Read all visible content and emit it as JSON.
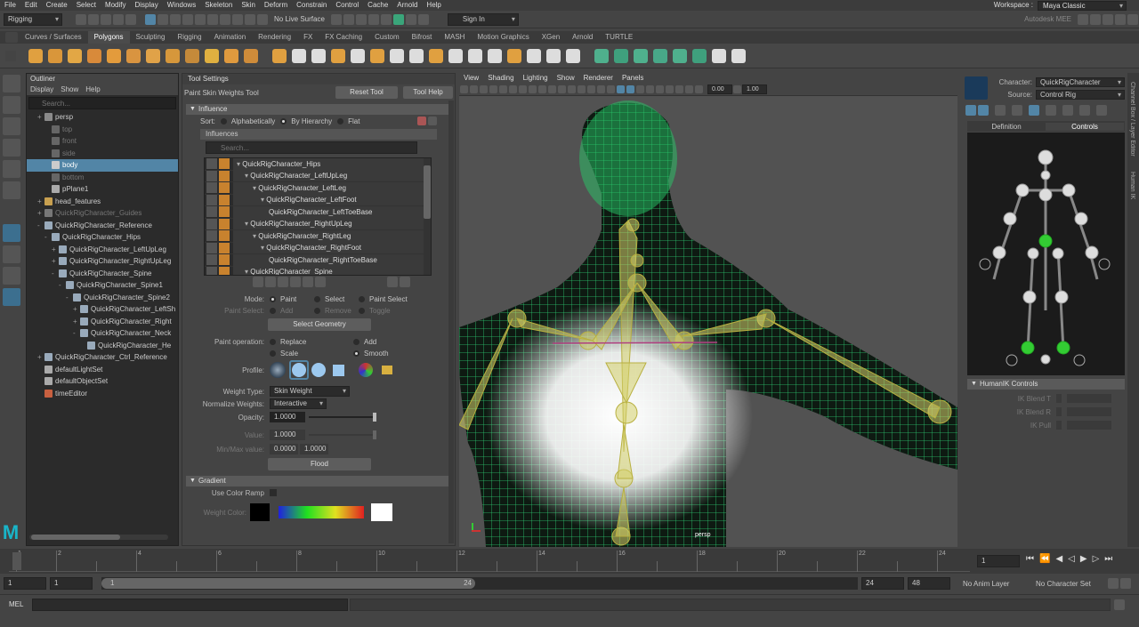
{
  "menubar": {
    "items": [
      "File",
      "Edit",
      "Create",
      "Select",
      "Modify",
      "Display",
      "Windows",
      "Skeleton",
      "Skin",
      "Deform",
      "Constrain",
      "Control",
      "Cache",
      "Arnold",
      "Help"
    ],
    "workspace_label": "Workspace :",
    "workspace_value": "Maya Classic"
  },
  "statusline": {
    "menuset": "Rigging",
    "live_surface": "No Live Surface",
    "sign_in": "Sign In",
    "brand": "Autodesk MEE"
  },
  "shelf": {
    "tabs": [
      "Curves / Surfaces",
      "Polygons",
      "Sculpting",
      "Rigging",
      "Animation",
      "Rendering",
      "FX",
      "FX Caching",
      "Custom",
      "Bifrost",
      "MASH",
      "Motion Graphics",
      "XGen",
      "Arnold",
      "TURTLE"
    ],
    "active_tab": "Polygons",
    "icon_colors": [
      "#e0a040",
      "#d9963a",
      "#e2a745",
      "#d88a3a",
      "#e39b3c",
      "#d99440",
      "#e0a248",
      "#d6973b",
      "#c58a3a",
      "#e0b040",
      "#e09a3e",
      "#cf8c3a",
      "#e0a040",
      "#ddd",
      "#ddd",
      "#e0a040",
      "#ddd",
      "#e0a040",
      "#ddd",
      "#ddd",
      "#e0a040",
      "#ddd",
      "#ddd",
      "#ddd",
      "#e0a040",
      "#ddd",
      "#ddd",
      "#ddd",
      "#4fb08d",
      "#3fa07d",
      "#4fb08d",
      "#48a888",
      "#4fb08d",
      "#3fa07d",
      "#ddd",
      "#ddd"
    ]
  },
  "outliner": {
    "title": "Outliner",
    "menu": [
      "Display",
      "Show",
      "Help"
    ],
    "search_placeholder": "Search...",
    "items": [
      {
        "label": "persp",
        "indent": 1,
        "exp": "+",
        "dim": false,
        "sel": false,
        "icon": "#8a8a8a"
      },
      {
        "label": "top",
        "indent": 2,
        "exp": "",
        "dim": true,
        "sel": false,
        "icon": "#666"
      },
      {
        "label": "front",
        "indent": 2,
        "exp": "",
        "dim": true,
        "sel": false,
        "icon": "#666"
      },
      {
        "label": "side",
        "indent": 2,
        "exp": "",
        "dim": true,
        "sel": false,
        "icon": "#666"
      },
      {
        "label": "body",
        "indent": 2,
        "exp": "",
        "dim": false,
        "sel": true,
        "icon": "#ccc"
      },
      {
        "label": "bottom",
        "indent": 2,
        "exp": "",
        "dim": true,
        "sel": false,
        "icon": "#666"
      },
      {
        "label": "pPlane1",
        "indent": 2,
        "exp": "",
        "dim": false,
        "sel": false,
        "icon": "#aaa"
      },
      {
        "label": "head_features",
        "indent": 1,
        "exp": "+",
        "dim": false,
        "sel": false,
        "icon": "#c8a050"
      },
      {
        "label": "QuickRigCharacter_Guides",
        "indent": 1,
        "exp": "+",
        "dim": true,
        "sel": false,
        "icon": "#777"
      },
      {
        "label": "QuickRigCharacter_Reference",
        "indent": 1,
        "exp": "-",
        "dim": false,
        "sel": false,
        "icon": "#9ab"
      },
      {
        "label": "QuickRigCharacter_Hips",
        "indent": 2,
        "exp": "-",
        "dim": false,
        "sel": false,
        "icon": "#9ab"
      },
      {
        "label": "QuickRigCharacter_LeftUpLeg",
        "indent": 3,
        "exp": "+",
        "dim": false,
        "sel": false,
        "icon": "#9ab"
      },
      {
        "label": "QuickRigCharacter_RightUpLeg",
        "indent": 3,
        "exp": "+",
        "dim": false,
        "sel": false,
        "icon": "#9ab"
      },
      {
        "label": "QuickRigCharacter_Spine",
        "indent": 3,
        "exp": "-",
        "dim": false,
        "sel": false,
        "icon": "#9ab"
      },
      {
        "label": "QuickRigCharacter_Spine1",
        "indent": 4,
        "exp": "-",
        "dim": false,
        "sel": false,
        "icon": "#9ab"
      },
      {
        "label": "QuickRigCharacter_Spine2",
        "indent": 5,
        "exp": "-",
        "dim": false,
        "sel": false,
        "icon": "#9ab"
      },
      {
        "label": "QuickRigCharacter_LeftSh",
        "indent": 6,
        "exp": "+",
        "dim": false,
        "sel": false,
        "icon": "#9ab"
      },
      {
        "label": "QuickRigCharacter_Right",
        "indent": 6,
        "exp": "+",
        "dim": false,
        "sel": false,
        "icon": "#9ab"
      },
      {
        "label": "QuickRigCharacter_Neck",
        "indent": 6,
        "exp": "-",
        "dim": false,
        "sel": false,
        "icon": "#9ab"
      },
      {
        "label": "QuickRigCharacter_He",
        "indent": 7,
        "exp": "",
        "dim": false,
        "sel": false,
        "icon": "#9ab"
      },
      {
        "label": "QuickRigCharacter_Ctrl_Reference",
        "indent": 1,
        "exp": "+",
        "dim": false,
        "sel": false,
        "icon": "#9ab"
      },
      {
        "label": "defaultLightSet",
        "indent": 1,
        "exp": "",
        "dim": false,
        "sel": false,
        "icon": "#aaa"
      },
      {
        "label": "defaultObjectSet",
        "indent": 1,
        "exp": "",
        "dim": false,
        "sel": false,
        "icon": "#aaa"
      },
      {
        "label": "timeEditor",
        "indent": 1,
        "exp": "",
        "dim": false,
        "sel": false,
        "icon": "#c86040"
      }
    ]
  },
  "tool": {
    "title": "Tool Settings",
    "tool_name": "Paint Skin Weights Tool",
    "reset_label": "Reset Tool",
    "help_label": "Tool Help",
    "influence_section": "Influence",
    "sort_label": "Sort:",
    "sort_alpha": "Alphabetically",
    "sort_hier": "By Hierarchy",
    "sort_flat": "Flat",
    "influences_label": "Influences",
    "search_placeholder": "Search...",
    "influences": [
      {
        "label": "QuickRigCharacter_Hips",
        "indent": 0
      },
      {
        "label": "QuickRigCharacter_LeftUpLeg",
        "indent": 1
      },
      {
        "label": "QuickRigCharacter_LeftLeg",
        "indent": 2
      },
      {
        "label": "QuickRigCharacter_LeftFoot",
        "indent": 3
      },
      {
        "label": "QuickRigCharacter_LeftToeBase",
        "indent": 4
      },
      {
        "label": "QuickRigCharacter_RightUpLeg",
        "indent": 1
      },
      {
        "label": "QuickRigCharacter_RightLeg",
        "indent": 2
      },
      {
        "label": "QuickRigCharacter_RightFoot",
        "indent": 3
      },
      {
        "label": "QuickRigCharacter_RightToeBase",
        "indent": 4
      },
      {
        "label": "QuickRigCharacter_Spine",
        "indent": 1
      }
    ],
    "mode_label": "Mode:",
    "mode_paint": "Paint",
    "mode_select": "Select",
    "mode_paint_select": "Paint Select",
    "paint_select_label": "Paint Select:",
    "ps_add": "Add",
    "ps_remove": "Remove",
    "ps_toggle": "Toggle",
    "select_geometry": "Select Geometry",
    "paint_op_label": "Paint operation:",
    "op_replace": "Replace",
    "op_add": "Add",
    "op_scale": "Scale",
    "op_smooth": "Smooth",
    "profile_label": "Profile:",
    "weight_type_label": "Weight Type:",
    "weight_type_value": "Skin Weight",
    "normalize_label": "Normalize Weights:",
    "normalize_value": "Interactive",
    "opacity_label": "Opacity:",
    "opacity_value": "1.0000",
    "value_label": "Value:",
    "value_value": "1.0000",
    "minmax_label": "Min/Max value:",
    "min_value": "0.0000",
    "max_value": "1.0000",
    "flood_label": "Flood",
    "gradient_section": "Gradient",
    "use_color_ramp": "Use Color Ramp",
    "weight_color_label": "Weight Color:"
  },
  "viewport": {
    "menu": [
      "View",
      "Shading",
      "Lighting",
      "Show",
      "Renderer",
      "Panels"
    ],
    "field1": "0.00",
    "field2": "1.00",
    "camera_label": "persp"
  },
  "hik": {
    "character_label": "Character:",
    "character_value": "QuickRigCharacter",
    "source_label": "Source:",
    "source_value": "Control Rig",
    "tab_definition": "Definition",
    "tab_controls": "Controls",
    "section_controls": "HumanIK Controls",
    "ik_blend_t": "IK Blend T",
    "ik_blend_r": "IK Blend R",
    "ik_pull": "IK Pull"
  },
  "rightstrip": {
    "label1": "Channel Box / Layer Editor",
    "label2": "Human IK"
  },
  "timeline": {
    "ticks": [
      "1",
      "2",
      "4",
      "6",
      "8",
      "10",
      "12",
      "14",
      "16",
      "18",
      "20",
      "22",
      "24"
    ],
    "current_frame": "1",
    "range_start": "1",
    "range_inner_start": "1",
    "range_slider_start": "1",
    "range_slider_end": "24",
    "range_inner_end": "24",
    "range_end": "48",
    "anim_layer": "No Anim Layer",
    "char_set": "No Character Set"
  },
  "cmdline": {
    "label": "MEL"
  },
  "colors": {
    "accent": "#5285a6",
    "mesh": "#2fe07a",
    "joint": "#d4d06a"
  }
}
